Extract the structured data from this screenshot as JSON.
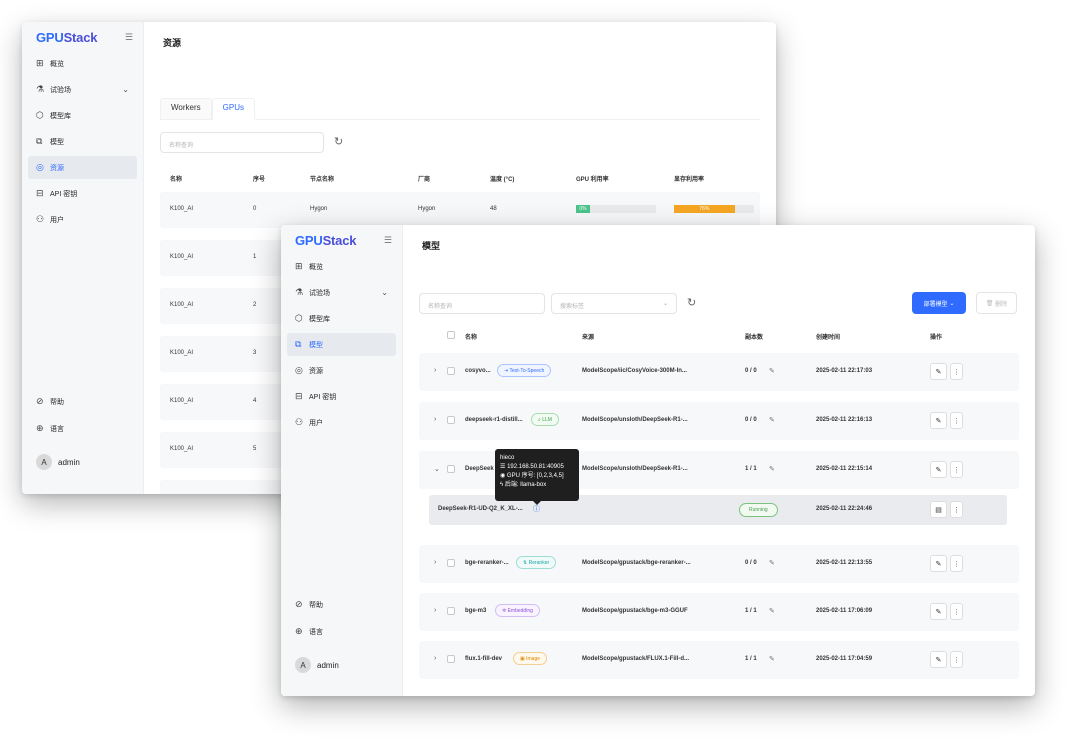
{
  "brand": {
    "name_part1": "GPU",
    "name_part2": "Stack"
  },
  "sidebar": {
    "items": [
      {
        "label": "概览",
        "icon": "dashboard-icon"
      },
      {
        "label": "试验场",
        "icon": "flask-icon"
      },
      {
        "label": "模型库",
        "icon": "cube-icon"
      },
      {
        "label": "模型",
        "icon": "model-icon"
      },
      {
        "label": "资源",
        "icon": "resource-icon"
      },
      {
        "label": "API 密钥",
        "icon": "lock-icon"
      },
      {
        "label": "用户",
        "icon": "users-icon"
      }
    ],
    "help_label": "帮助",
    "language_label": "语言",
    "user": {
      "initial": "A",
      "name": "admin"
    }
  },
  "resources": {
    "title": "资源",
    "tabs": [
      {
        "label": "Workers"
      },
      {
        "label": "GPUs"
      }
    ],
    "search_placeholder": "名称查询",
    "columns": [
      "名称",
      "序号",
      "节点名称",
      "厂商",
      "温度 (°C)",
      "GPU 利用率",
      "显存利用率"
    ],
    "rows": [
      {
        "name": "K100_AI",
        "index": "0",
        "node": "Hygon",
        "vendor": "Hygon",
        "temp": "48",
        "gpu_util_label": "0%",
        "gpu_util": 0,
        "mem_util_label": "76%",
        "mem_util": 76
      },
      {
        "name": "K100_AI",
        "index": "1"
      },
      {
        "name": "K100_AI",
        "index": "2"
      },
      {
        "name": "K100_AI",
        "index": "3"
      },
      {
        "name": "K100_AI",
        "index": "4"
      },
      {
        "name": "K100_AI",
        "index": "5"
      }
    ]
  },
  "models": {
    "title": "模型",
    "search_placeholder": "名称查询",
    "filter_placeholder": "搜索标签",
    "deploy_label": "部署模型",
    "delete_label": "删除",
    "columns": {
      "name": "名称",
      "source": "来源",
      "replicas": "副本数",
      "created": "创建时间",
      "actions": "操作"
    },
    "rows": [
      {
        "name": "cosyvo...",
        "tag": "Text-To-Speech",
        "tag_icon": "⇥",
        "tag_color": "#2f6bff",
        "source": "ModelScope/iic/CosyVoice-300M-In...",
        "replicas": "0 / 0",
        "created": "2025-02-11 22:17:03",
        "expanded": false
      },
      {
        "name": "deepseek-r1-distill...",
        "tag": "LLM",
        "tag_icon": "⌕",
        "tag_color": "#39a845",
        "source": "ModelScope/unsloth/DeepSeek-R1-...",
        "replicas": "0 / 0",
        "created": "2025-02-11 22:16:13",
        "expanded": false
      },
      {
        "name": "DeepSeek",
        "tag": "",
        "source": "ModelScope/unsloth/DeepSeek-R1-...",
        "replicas": "1 / 1",
        "created": "2025-02-11 22:15:14",
        "expanded": true
      },
      {
        "name": "bge-reranker-...",
        "tag": "Reranker",
        "tag_icon": "⇅",
        "tag_color": "#19a7a1",
        "source": "ModelScope/gpustack/bge-reranker-...",
        "replicas": "0 / 0",
        "created": "2025-02-11 22:13:55",
        "expanded": false
      },
      {
        "name": "bge-m3",
        "tag": "Embedding",
        "tag_icon": "✲",
        "tag_color": "#8b4fd8",
        "source": "ModelScope/gpustack/bge-m3-GGUF",
        "replicas": "1 / 1",
        "created": "2025-02-11 17:06:09",
        "expanded": false
      },
      {
        "name": "flux.1-fill-dev",
        "tag": "Image",
        "tag_icon": "▣",
        "tag_color": "#e08a00",
        "source": "ModelScope/gpustack/FLUX.1-Fill-d...",
        "replicas": "1 / 1",
        "created": "2025-02-11 17:04:59",
        "expanded": false
      }
    ],
    "instance": {
      "name": "DeepSeek-R1-UD-Q2_K_XL-...",
      "status": "Running",
      "created": "2025-02-11 22:24:46"
    },
    "tooltip": {
      "host": "hieco",
      "address": "192.168.50.81:40905",
      "gpu": "GPU 序号: [0,2,3,4,5]",
      "backend": "后端: llama-box"
    }
  },
  "colors": {
    "accent": "#2f6bff",
    "running": "#4a9d50",
    "mem_bar": "#f5a623",
    "gpu_bar": "#4cc38a"
  }
}
